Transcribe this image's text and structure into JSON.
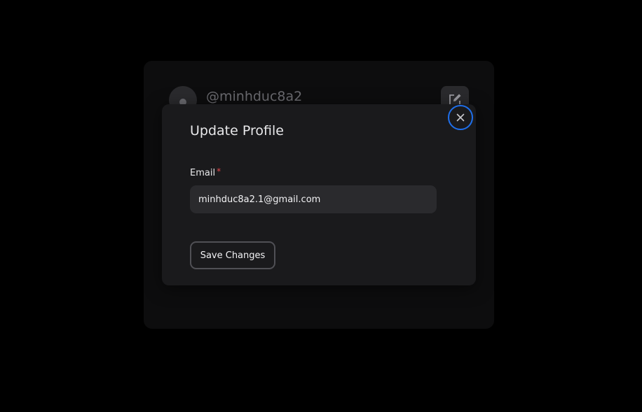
{
  "profile": {
    "username": "@minhduc8a2",
    "avatar_icon": "user-icon",
    "edit_icon": "edit-icon"
  },
  "modal": {
    "title": "Update Profile",
    "close_icon": "close-icon",
    "email_label": "Email",
    "required_mark": "*",
    "email_value": "minhduc8a2.1@gmail.com",
    "save_label": "Save Changes"
  },
  "colors": {
    "page_background": "#000000",
    "card_background": "#0d0d0e",
    "modal_background": "#1a1a1c",
    "input_background": "#2a2a2d",
    "focus_ring": "#1f6feb",
    "required": "#e5484d"
  }
}
